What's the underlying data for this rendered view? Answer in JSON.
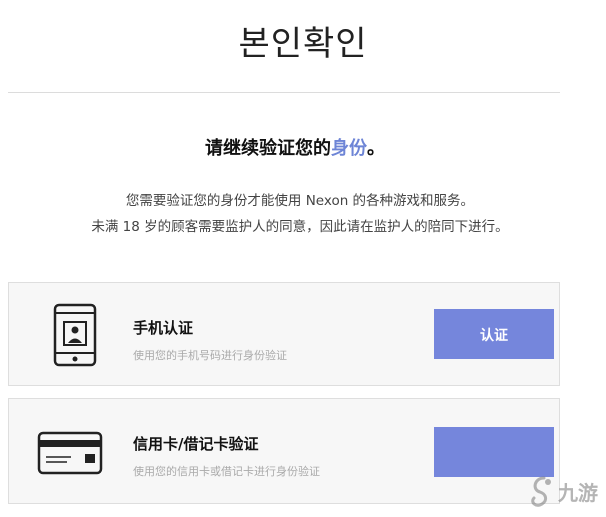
{
  "page_title": "본인확인",
  "headline": {
    "prefix": "请继续验证您的",
    "accent": "身份",
    "suffix": "。",
    "accent_color": "#6e85d6"
  },
  "description": {
    "line1": "您需要验证您的身份才能使用 Nexon 的各种游戏和服务。",
    "line2": "未满 18 岁的顾客需要监护人的同意，因此请在监护人的陪同下进行。"
  },
  "options": [
    {
      "icon": "smartphone-icon",
      "title": "手机认证",
      "subtitle": "使用您的手机号码进行身份验证",
      "button_label": "认证"
    },
    {
      "icon": "credit-card-icon",
      "title": "信用卡/借记卡验证",
      "subtitle": "使用您的信用卡或借记卡进行身份验证",
      "button_label": ""
    }
  ],
  "button_color": "#7586dc",
  "watermark": {
    "icon": "jiuyou-logo-icon",
    "text": "九游"
  }
}
